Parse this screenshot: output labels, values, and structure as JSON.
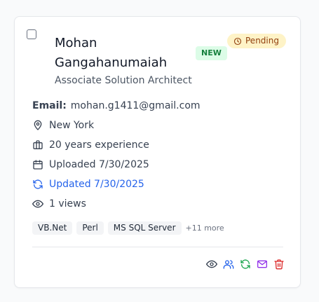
{
  "candidate": {
    "name": "Mohan Gangahanumaiah",
    "title": "Associate Solution Architect",
    "new_badge": "NEW",
    "status": "Pending",
    "email_label": "Email:",
    "email": "mohan.g1411@gmail.com",
    "location": "New York",
    "experience": "20 years experience",
    "uploaded": "Uploaded 7/30/2025",
    "updated": "Updated 7/30/2025",
    "views": "1 views",
    "skills": [
      "VB.Net",
      "Perl",
      "MS SQL Server"
    ],
    "more_skills": "+11 more"
  },
  "colors": {
    "new_badge_bg": "#dcfce7",
    "new_badge_text": "#15803d",
    "pending_bg": "#fef3c7",
    "pending_text": "#92400e",
    "updated_text": "#2563eb",
    "view_icon": "#374151",
    "share_icon": "#2563eb",
    "refresh_icon": "#16a34a",
    "mail_icon": "#9333ea",
    "delete_icon": "#dc2626"
  },
  "icons": {
    "status": "clock-icon",
    "location": "map-pin-icon",
    "experience": "briefcase-icon",
    "uploaded": "calendar-icon",
    "updated": "refresh-icon",
    "views": "eye-icon",
    "actions": [
      "eye-icon",
      "users-icon",
      "refresh-icon",
      "mail-icon",
      "trash-icon"
    ]
  }
}
